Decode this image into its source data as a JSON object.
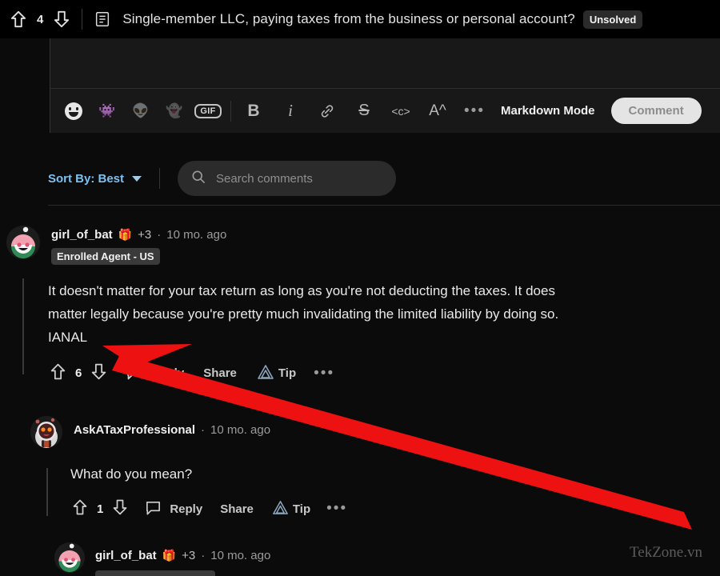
{
  "topbar": {
    "upvote_icon": "up-arrow-icon",
    "score": "4",
    "downvote_icon": "down-arrow-icon",
    "post_icon": "post-document-icon",
    "title": "Single-member LLC, paying taxes from the business or personal account?",
    "badge": "Unsolved"
  },
  "editor": {
    "placeholder": "",
    "tools": [
      {
        "name": "emoji-icon",
        "label": ""
      },
      {
        "name": "snoo-avatar-icon",
        "label": "👾"
      },
      {
        "name": "snoo-avatar-2-icon",
        "label": "👽"
      },
      {
        "name": "snoo-avatar-3-icon",
        "label": "👻"
      },
      {
        "name": "gif-icon",
        "label": "GIF"
      }
    ],
    "format_bold": "B",
    "format_italic": "i",
    "format_link": "link-icon",
    "format_strike": "S",
    "format_code": "<c>",
    "format_heading": "A^",
    "more": "•••",
    "markdown_mode": "Markdown Mode",
    "comment_button": "Comment"
  },
  "sortbar": {
    "sort_label": "Sort By: Best",
    "search_placeholder": "Search comments",
    "search_value": ""
  },
  "comments": [
    {
      "username": "girl_of_bat",
      "award": "🎁",
      "award_count": "+3",
      "dot": "·",
      "time": "10 mo. ago",
      "flair": "Enrolled Agent - US",
      "body_line1": "It doesn't matter for your tax return as long as you're not deducting the taxes. It does",
      "body_line2": "matter legally because you're pretty much invalidating the limited liability by doing so.",
      "body_line3": "IANAL",
      "score": "6",
      "reply": "Reply",
      "share": "Share",
      "tip": "Tip",
      "more": "•••"
    },
    {
      "username": "AskATaxProfessional",
      "dot": "·",
      "time": "10 mo. ago",
      "body_line1": "What do you mean?",
      "score": "1",
      "reply": "Reply",
      "share": "Share",
      "tip": "Tip",
      "more": "•••"
    },
    {
      "username": "girl_of_bat",
      "award": "🎁",
      "award_count": "+3",
      "dot": "·",
      "time": "10 mo. ago"
    }
  ],
  "annotation": {
    "type": "red-arrow",
    "color": "#ee1111",
    "points_to": "IANAL"
  },
  "watermark": "TekZone.vn",
  "colors": {
    "background": "#0b0b0b",
    "topbar": "#000000",
    "editor": "#181818",
    "accent_blue": "#7cc0f0",
    "text": "#e9e9e9",
    "muted": "#9b9b9b",
    "arrow_red": "#ee1111"
  }
}
